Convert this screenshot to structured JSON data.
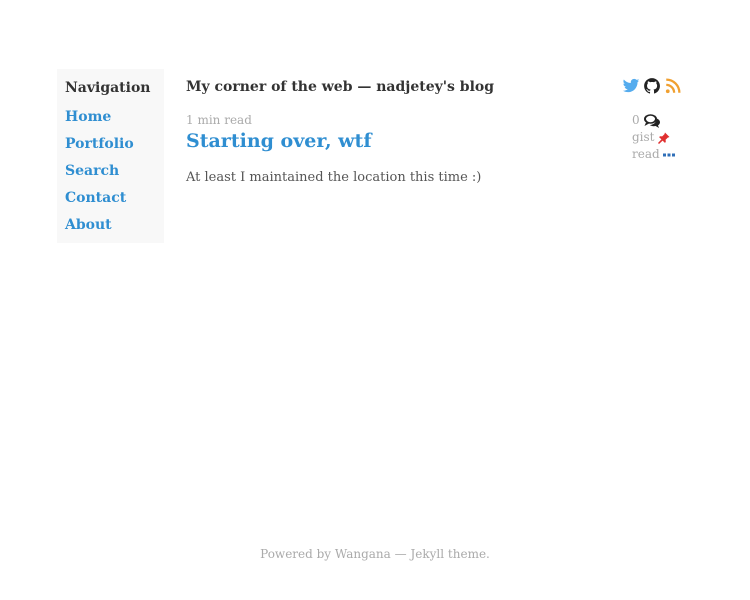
{
  "sidebar": {
    "title": "Navigation",
    "items": [
      {
        "label": "Home"
      },
      {
        "label": "Portfolio"
      },
      {
        "label": "Search"
      },
      {
        "label": "Contact"
      },
      {
        "label": "About"
      }
    ]
  },
  "header": {
    "site_title": "My corner of the web — nadjetey's blog",
    "social_icons": [
      "twitter-icon",
      "github-icon",
      "rss-icon"
    ]
  },
  "post": {
    "read_time": "1 min read",
    "title": "Starting over, wtf",
    "excerpt": "At least I maintained the location this time :)",
    "meta": {
      "comment_count": "0",
      "gist_label": "gist",
      "read_label": "read"
    }
  },
  "footer": {
    "prefix": "Powered by",
    "link_label": "Wangana",
    "suffix": "— Jekyll theme."
  },
  "colors": {
    "link": "#2f8ed1",
    "twitter": "#55acee",
    "rss": "#f0a030",
    "muted": "#aaaaaa",
    "gist_pin": "#e03030"
  }
}
